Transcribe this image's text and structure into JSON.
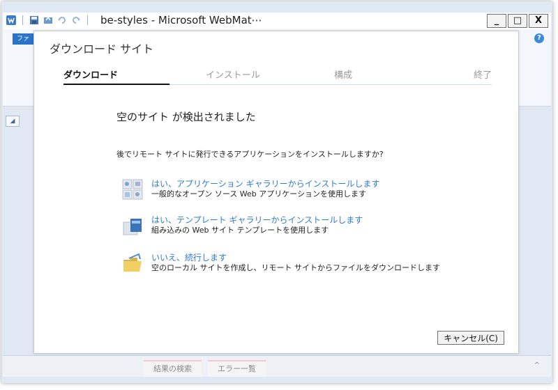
{
  "window": {
    "title": "be-styles - Microsoft WebMat⋯",
    "min_label": "_",
    "max_label": "□",
    "close_label": "X"
  },
  "background_app": {
    "ribbon_tab_label": "ファ",
    "bottom_tabs": [
      "結果の検索",
      "エラー一覧"
    ]
  },
  "dialog": {
    "title": "ダウンロード サイト",
    "steps": [
      {
        "label": "ダウンロード",
        "active": true
      },
      {
        "label": "インストール",
        "active": false
      },
      {
        "label": "構成",
        "active": false
      },
      {
        "label": "終了",
        "active": false
      }
    ],
    "heading": "空のサイト が検出されました",
    "question": "後でリモート サイトに発行できるアプリケーションをインストールしますか?",
    "options": [
      {
        "icon": "app-gallery-icon",
        "link": "はい、アプリケーション ギャラリーからインストールします",
        "desc": "一般的なオープン ソース Web アプリケーションを使用します"
      },
      {
        "icon": "template-gallery-icon",
        "link": "はい、テンプレート ギャラリーからインストールします",
        "desc": "組み込みの Web サイト テンプレートを使用します"
      },
      {
        "icon": "folder-icon",
        "link": "いいえ、続行します",
        "desc": "空のローカル サイトを作成し、リモート サイトからファイルをダウンロードします"
      }
    ],
    "cancel_label": "キャンセル(C)"
  },
  "colors": {
    "link": "#2f7ccf",
    "step_inactive": "#9a9a9a",
    "step_underline": "#c8dbec"
  }
}
